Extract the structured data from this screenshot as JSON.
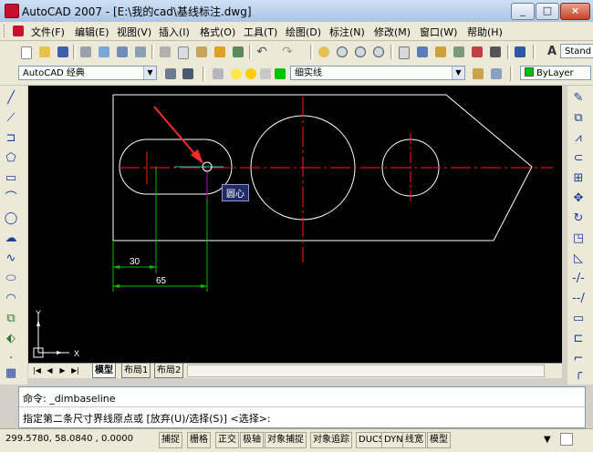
{
  "window": {
    "title": "AutoCAD 2007 - [E:\\我的cad\\基线标注.dwg]",
    "minimize_label": "_",
    "restore_label": "□",
    "close_label": "×"
  },
  "menu": {
    "items": [
      "文件(F)",
      "编辑(E)",
      "视图(V)",
      "插入(I)",
      "格式(O)",
      "工具(T)",
      "绘图(D)",
      "标注(N)",
      "修改(M)",
      "窗口(W)",
      "帮助(H)"
    ]
  },
  "toolbar": {
    "standard_fragment": "Stand",
    "workspace": "AutoCAD 经典",
    "layer": "细实线",
    "color": "ByLayer"
  },
  "canvas": {
    "tooltip": "圆心",
    "dim_30": "30",
    "dim_65": "65",
    "ucs_x": "X",
    "ucs_y": "Y"
  },
  "tabs": {
    "items": [
      "模型",
      "布局1",
      "布局2"
    ],
    "active": "模型"
  },
  "command": {
    "line1": "命令: _dimbaseline",
    "line2": "指定第二条尺寸界线原点或 [放弃(U)/选择(S)] <选择>:"
  },
  "statusbar": {
    "coords": "299.5780, 58.0840 , 0.0000",
    "toggles": [
      "捕捉",
      "栅格",
      "正交",
      "极轴",
      "对象捕捉",
      "对象追踪",
      "DUCS",
      "DYN",
      "线宽",
      "模型"
    ]
  },
  "colors": {
    "canvas_bg": "#000000",
    "geometry": "#ffffff",
    "centerline": "#ff0000",
    "dimension": "#00c000",
    "annotation_arrow": "#ff2a2a",
    "snap_marker": "#ffff00",
    "tooltip_bg": "#1f2a66"
  }
}
